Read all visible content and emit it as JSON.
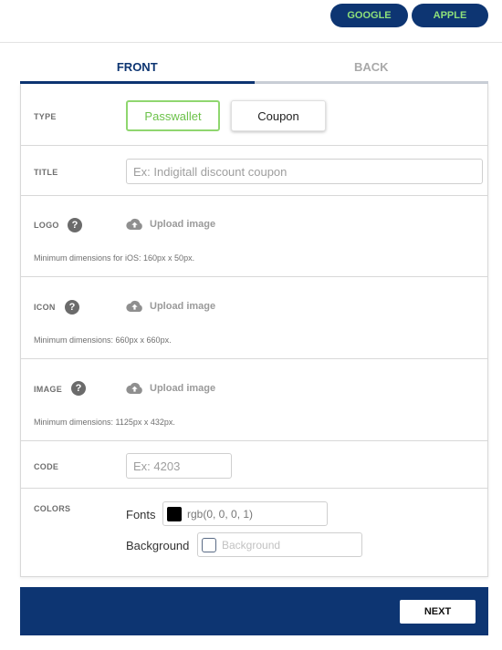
{
  "header": {
    "google_label": "GOOGLE",
    "apple_label": "APPLE"
  },
  "tabs": {
    "front": "FRONT",
    "back": "BACK"
  },
  "form": {
    "type": {
      "label": "TYPE",
      "options": [
        "Passwallet",
        "Coupon"
      ],
      "selected": "Passwallet"
    },
    "title": {
      "label": "TITLE",
      "placeholder": "Ex: Indigitall discount coupon",
      "value": ""
    },
    "logo": {
      "label": "LOGO",
      "upload_label": "Upload image",
      "hint": "Minimum dimensions for iOS: 160px x 50px."
    },
    "icon": {
      "label": "ICON",
      "upload_label": "Upload image",
      "hint": "Minimum dimensions: 660px x 660px."
    },
    "image": {
      "label": "IMAGE",
      "upload_label": "Upload image",
      "hint": "Minimum dimensions: 1125px x 432px."
    },
    "code": {
      "label": "CODE",
      "placeholder": "Ex: 4203",
      "value": ""
    },
    "colors": {
      "label": "COLORS",
      "fonts_label": "Fonts",
      "fonts_value": "rgb(0, 0, 0, 1)",
      "background_label": "Background",
      "background_placeholder": "Background"
    },
    "help_symbol": "?"
  },
  "footer": {
    "next_label": "NEXT"
  },
  "colors": {
    "primary": "#0d3572",
    "accent_green": "#8ee07a",
    "selected_border": "#8fd66f"
  }
}
